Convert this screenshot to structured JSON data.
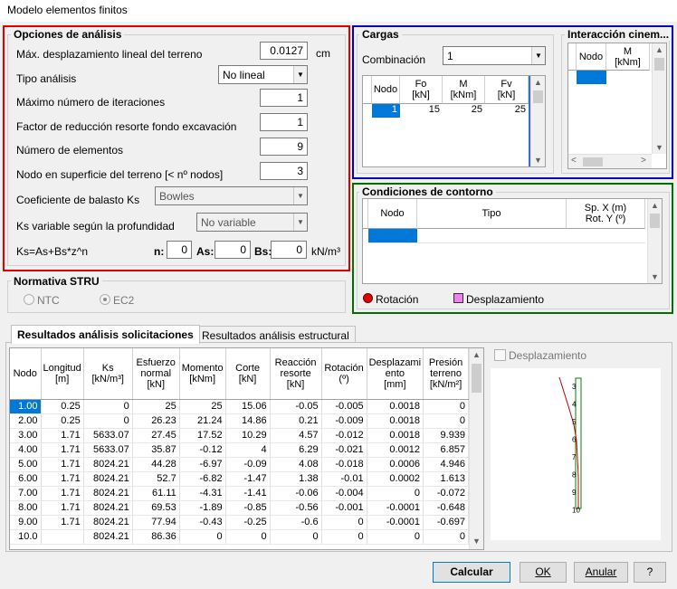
{
  "window": {
    "title": "Modelo elementos finitos"
  },
  "opciones": {
    "title": "Opciones de análisis",
    "desplazamiento_label": "Máx. desplazamiento lineal del terreno",
    "desplazamiento_value": "0.0127",
    "desplazamiento_unit": "cm",
    "tipo_label": "Tipo análisis",
    "tipo_value": "No lineal",
    "iteraciones_label": "Máximo número de iteraciones",
    "iteraciones_value": "1",
    "factor_label": "Factor de reducción resorte fondo excavación",
    "factor_value": "1",
    "elementos_label": "Número de elementos",
    "elementos_value": "9",
    "nodo_label": "Nodo en superficie del terreno [< nº nodos]",
    "nodo_value": "3",
    "balasto_label": "Coeficiente de balasto Ks",
    "balasto_value": "Bowles",
    "ks_var_label": "Ks variable según la profundidad",
    "ks_var_value": "No variable",
    "formula_label": "Ks=As+Bs*z^n",
    "n_label": "n:",
    "n_value": "0",
    "as_label": "As:",
    "as_value": "0",
    "bs_label": "Bs:",
    "bs_value": "0",
    "bs_unit": "kN/m³"
  },
  "cargas": {
    "title": "Cargas",
    "combinacion_label": "Combinación",
    "combinacion_value": "1",
    "headers": [
      "Nodo",
      "Fo\n[kN]",
      "M\n[kNm]",
      "Fv\n[kN]"
    ],
    "row": [
      "1",
      "15",
      "25",
      "25"
    ]
  },
  "interaccion": {
    "title": "Interacción cinem...",
    "headers": [
      "Nodo",
      "M\n[kNm]"
    ]
  },
  "contorno": {
    "title": "Condiciones de contorno",
    "headers": [
      "Nodo",
      "Tipo",
      "Sp. X (m)\nRot. Y (º)"
    ],
    "legend_rotacion": "Rotación",
    "legend_desplazamiento": "Desplazamiento"
  },
  "normativa": {
    "title": "Normativa STRU",
    "ntc": "NTC",
    "ec2": "EC2"
  },
  "tabs": {
    "solicitaciones": "Resultados análisis solicitaciones",
    "estructural": "Resultados análisis estructural"
  },
  "resultados": {
    "headers": [
      "Nodo",
      "Longitud\n[m]",
      "Ks\n[kN/m³]",
      "Esfuerzo\nnormal\n[kN]",
      "Momento\n[kNm]",
      "Corte\n[kN]",
      "Reacción\nresorte\n[kN]",
      "Rotación\n(º)",
      "Desplazami\nento\n[mm]",
      "Presión\nterreno\n[kN/m²]"
    ],
    "rows": [
      [
        "1.00",
        "0.25",
        "0",
        "25",
        "25",
        "15.06",
        "-0.05",
        "-0.005",
        "0.0018",
        "0"
      ],
      [
        "2.00",
        "0.25",
        "0",
        "26.23",
        "21.24",
        "14.86",
        "0.21",
        "-0.009",
        "0.0018",
        "0"
      ],
      [
        "3.00",
        "1.71",
        "5633.07",
        "27.45",
        "17.52",
        "10.29",
        "4.57",
        "-0.012",
        "0.0018",
        "9.939"
      ],
      [
        "4.00",
        "1.71",
        "5633.07",
        "35.87",
        "-0.12",
        "4",
        "6.29",
        "-0.021",
        "0.0012",
        "6.857"
      ],
      [
        "5.00",
        "1.71",
        "8024.21",
        "44.28",
        "-6.97",
        "-0.09",
        "4.08",
        "-0.018",
        "0.0006",
        "4.946"
      ],
      [
        "6.00",
        "1.71",
        "8024.21",
        "52.7",
        "-6.82",
        "-1.47",
        "1.38",
        "-0.01",
        "0.0002",
        "1.613"
      ],
      [
        "7.00",
        "1.71",
        "8024.21",
        "61.11",
        "-4.31",
        "-1.41",
        "-0.06",
        "-0.004",
        "0",
        "-0.072"
      ],
      [
        "8.00",
        "1.71",
        "8024.21",
        "69.53",
        "-1.89",
        "-0.85",
        "-0.56",
        "-0.001",
        "-0.0001",
        "-0.648"
      ],
      [
        "9.00",
        "1.71",
        "8024.21",
        "77.94",
        "-0.43",
        "-0.25",
        "-0.6",
        "0",
        "-0.0001",
        "-0.697"
      ],
      [
        "10.0",
        "",
        "8024.21",
        "86.36",
        "0",
        "0",
        "0",
        "0",
        "0",
        "0"
      ]
    ]
  },
  "preview": {
    "desplazamiento_label": "Desplazamiento",
    "node_labels": [
      "3",
      "4",
      "5",
      "6",
      "7",
      "8",
      "9",
      "10"
    ]
  },
  "buttons": {
    "calcular": "Calcular",
    "ok": "OK",
    "anular": "Anular",
    "help": "?"
  },
  "colors": {
    "red_box": "#e00000",
    "blue_box": "#0000c0",
    "green_box": "#007000",
    "selection": "#0078d7"
  }
}
